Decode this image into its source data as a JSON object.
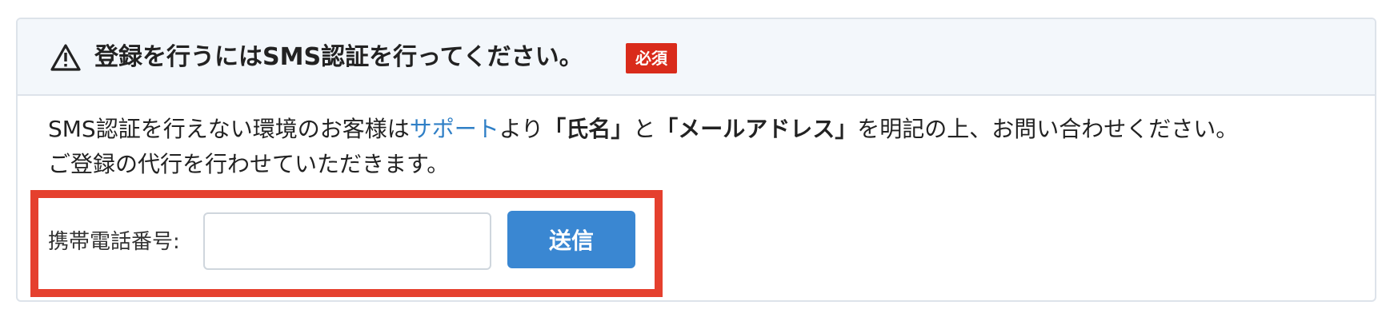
{
  "header": {
    "title": "登録を行うにはSMS認証を行ってください。",
    "required_badge": "必須",
    "icon": "warning-triangle-icon"
  },
  "notice": {
    "text_before_link": "SMS認証を行えない環境のお客様は",
    "support_link": "サポート",
    "text_after_link": "より",
    "name_quote": "「氏名」",
    "connector": "と",
    "email_quote": "「メールアドレス」",
    "text_end": "を明記の上、お問い合わせください。",
    "line2": "ご登録の代行を行わせていただきます。"
  },
  "form": {
    "phone_label": "携帯電話番号:",
    "phone_value": "",
    "phone_placeholder": "",
    "submit_label": "送信"
  },
  "colors": {
    "badge": "#d92b1b",
    "link": "#2f7fc6",
    "button": "#3a87d2",
    "highlight": "#e5402e",
    "header_bg": "#f3f7fb"
  }
}
